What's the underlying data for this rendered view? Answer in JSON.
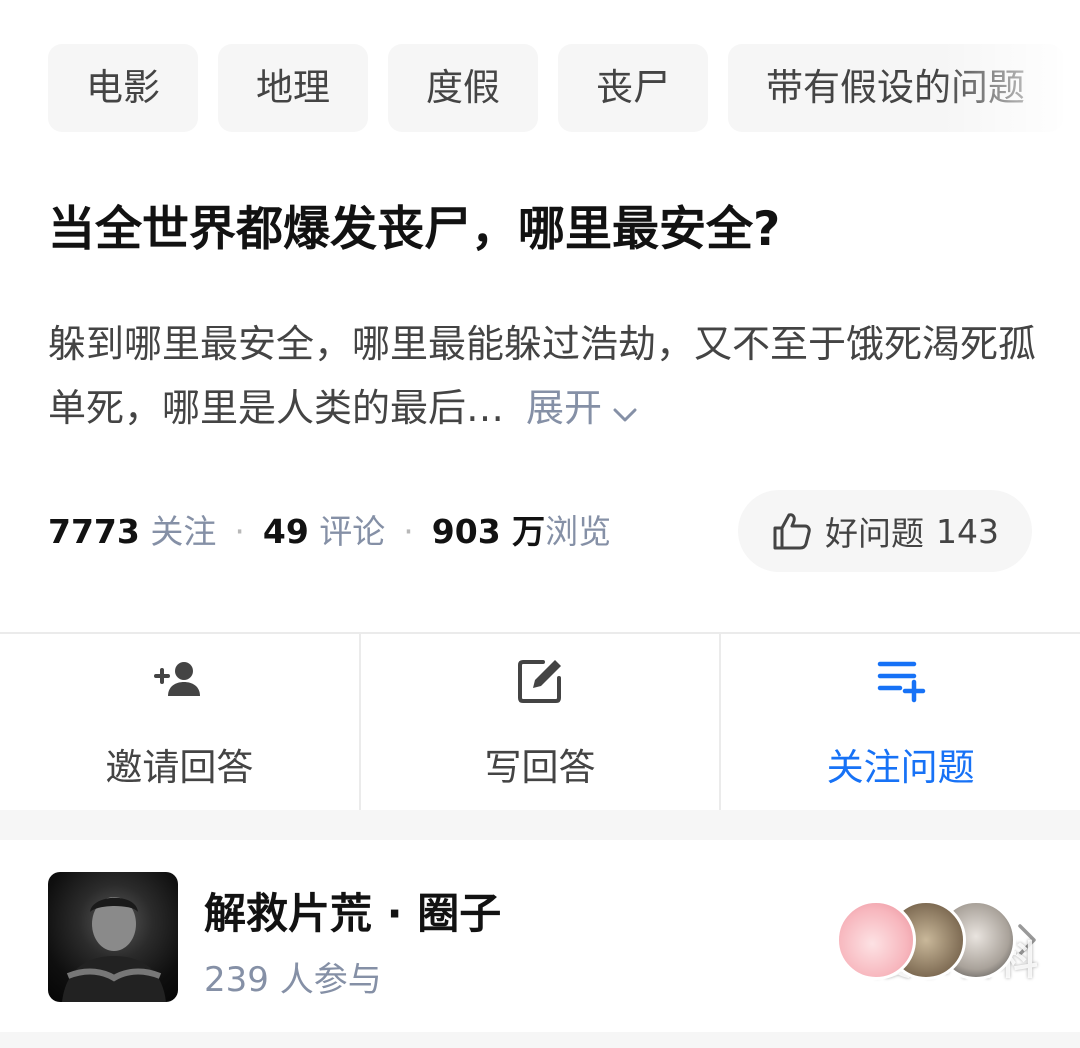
{
  "tags": [
    "电影",
    "地理",
    "度假",
    "丧尸",
    "带有假设的问题"
  ],
  "question": {
    "title": "当全世界都爆发丧尸，哪里最安全?",
    "description": "躲到哪里最安全，哪里最能躲过浩劫，又不至于饿死渴死孤单死，哪里是人类的最后…",
    "expand_label": "展开"
  },
  "stats": {
    "followers_num": "7773",
    "followers_label": "关注",
    "comments_num": "49",
    "comments_label": "评论",
    "views_num": "903 万",
    "views_label": "浏览"
  },
  "good_question": {
    "label": "好问题",
    "count": "143"
  },
  "actions": {
    "invite": "邀请回答",
    "write": "写回答",
    "follow": "关注问题"
  },
  "circle": {
    "name": "解救片荒 · 圈子",
    "participants": "239 人参与"
  },
  "watermark": "搜事百科",
  "icons": {
    "tag_fade": "none",
    "expand": "chevron-down-icon",
    "good": "thumbs-up-icon",
    "invite": "add-user-icon",
    "write": "edit-icon",
    "follow": "list-add-icon",
    "more": "chevron-right-icon"
  },
  "colors": {
    "accent": "#1772f6",
    "secondary_text": "#8590a6",
    "tag_bg": "#f6f6f6"
  }
}
